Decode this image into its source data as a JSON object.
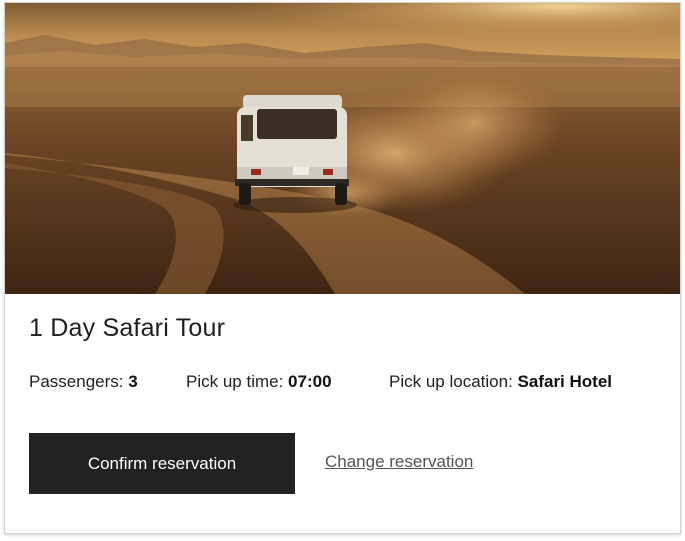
{
  "card": {
    "title": "1 Day Safari Tour",
    "details": [
      {
        "label": "Passengers:",
        "value": "3"
      },
      {
        "label": "Pick up time:",
        "value": "07:00"
      },
      {
        "label": "Pick up location:",
        "value": "Safari Hotel"
      }
    ],
    "actions": {
      "confirm_label": "Confirm reservation",
      "change_label": "Change reservation"
    }
  },
  "colors": {
    "button_bg": "#222222",
    "button_text": "#ffffff",
    "link_text": "#555555"
  }
}
